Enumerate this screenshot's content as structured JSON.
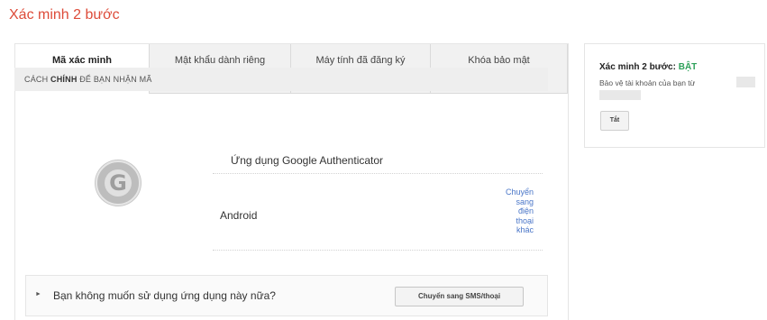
{
  "page": {
    "title": "Xác minh 2 bước"
  },
  "tabs": [
    {
      "label": "Mã xác minh"
    },
    {
      "label": "Mật khẩu dành riêng\ncho ứng dụng"
    },
    {
      "label": "Máy tính đã đăng ký"
    },
    {
      "label": "Khóa bảo mật"
    }
  ],
  "section": {
    "header_prefix": "CÁCH ",
    "header_bold": "CHÍNH",
    "header_suffix": " ĐỂ BẠN NHẬN MÃ"
  },
  "method": {
    "logo_letter": "G",
    "app_name": "Ứng dụng Google Authenticator",
    "device": "Android",
    "switch_link": "Chuyển\nsang\nđiện\nthoại\nkhác"
  },
  "question": {
    "arrow": "►",
    "text": "Bạn không muốn sử dụng ứng dụng này nữa?",
    "button": "Chuyển sang SMS/thoại"
  },
  "status": {
    "label": "Xác minh 2 bước: ",
    "state": "BẬT",
    "description": "Bảo vệ tài khoản của bạn từ",
    "off_button": "Tắt",
    "state_color": "#2ea15a"
  },
  "colors": {
    "accent_title": "#dd4b39",
    "link": "#4a76c8"
  }
}
